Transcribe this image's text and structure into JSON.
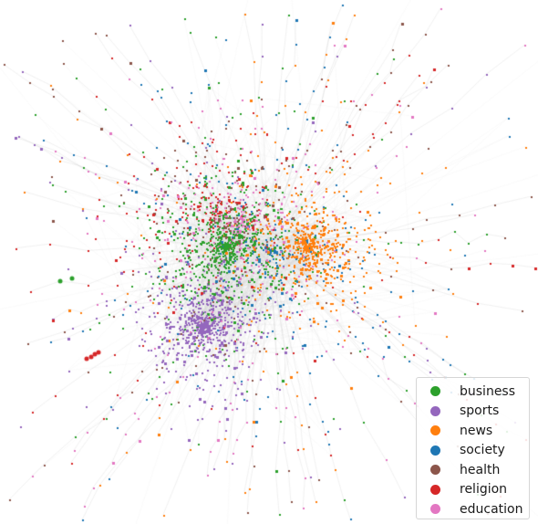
{
  "chart_data": {
    "type": "scatter",
    "subtype": "network-graph",
    "title": "",
    "xlabel": "",
    "ylabel": "",
    "axes_visible": false,
    "grid": false,
    "legend_position": "bottom-right",
    "edge_color": "#cccccc",
    "legend": [
      {
        "label": "business",
        "color": "#2ca02c"
      },
      {
        "label": "sports",
        "color": "#9467bd"
      },
      {
        "label": "news",
        "color": "#ff7f0e"
      },
      {
        "label": "society",
        "color": "#1f77b4"
      },
      {
        "label": "health",
        "color": "#8c564b"
      },
      {
        "label": "religion",
        "color": "#d62728"
      },
      {
        "label": "education",
        "color": "#e377c2"
      }
    ],
    "clusters": [
      {
        "category": "business",
        "center": [
          0.42,
          0.47
        ],
        "spread": 0.09,
        "count": 700
      },
      {
        "category": "sports",
        "center": [
          0.38,
          0.62
        ],
        "spread": 0.07,
        "count": 650
      },
      {
        "category": "news",
        "center": [
          0.57,
          0.47
        ],
        "spread": 0.08,
        "count": 600
      },
      {
        "category": "society",
        "center": [
          0.5,
          0.48
        ],
        "spread": 0.17,
        "count": 250
      },
      {
        "category": "health",
        "center": [
          0.42,
          0.44
        ],
        "spread": 0.14,
        "count": 180
      },
      {
        "category": "religion",
        "center": [
          0.4,
          0.4
        ],
        "spread": 0.12,
        "count": 220
      },
      {
        "category": "education",
        "center": [
          0.45,
          0.42
        ],
        "spread": 0.13,
        "count": 300
      }
    ]
  }
}
